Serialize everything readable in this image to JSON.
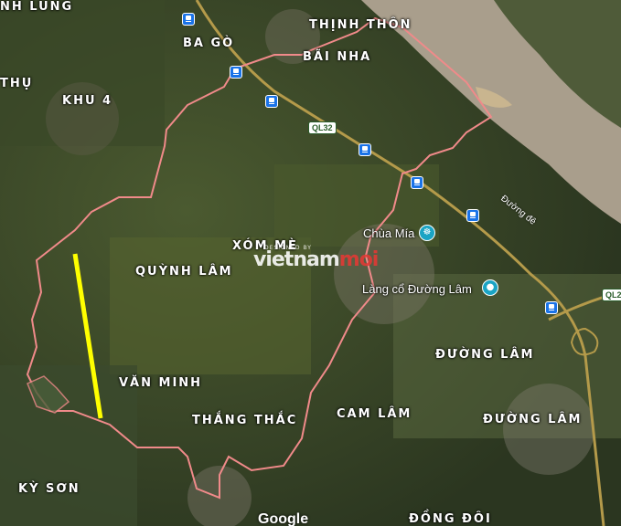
{
  "map": {
    "type": "satellite",
    "boundary_color": "#f08a8a",
    "highlight_color": "#ffff00",
    "watermark": {
      "tag": "DESIGNED BY",
      "text_a": "vietnam",
      "text_b": "moi"
    },
    "attribution": "Google"
  },
  "places": {
    "inh_lung": "NH LUNG",
    "ba_go": "BA GÒ",
    "thinh_thon": "THỊNH THÔN",
    "bai_nha": "BÃI NHA",
    "thu": "THỤ",
    "khu4": "KHU 4",
    "xom_me": "XÓM MÈ",
    "quynh_lam": "QUỲNH LÂM",
    "van_minh": "VĂN MINH",
    "thang_thac": "THẮNG THẮC",
    "cam_lam": "CAM LÂM",
    "duong_lam_1": "ĐƯỜNG LÂM",
    "duong_lam_2": "ĐƯỜNG LÂM",
    "ky_son": "KỲ SƠN",
    "dong_doi": "ĐỒNG ĐÔI"
  },
  "pois": {
    "chua_mia": "Chùa Mía",
    "lang_co": "Làng cổ Đường Lâm"
  },
  "roads": {
    "ql32": "QL32",
    "ql21": "QL2",
    "duong_de": "Đường đê"
  },
  "icons": {
    "bus": "bus-stop-icon",
    "temple": "temple-icon",
    "camera": "camera-icon"
  }
}
